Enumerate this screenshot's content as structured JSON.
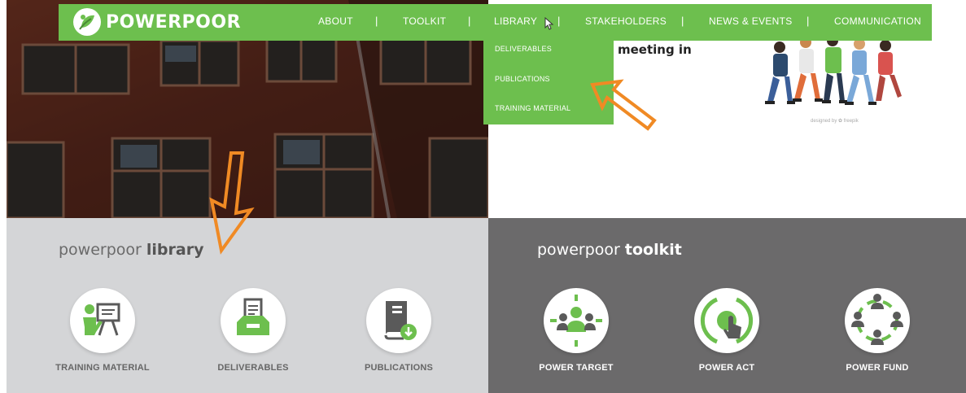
{
  "nav": {
    "logo_text": "POWERPOOR",
    "items": [
      {
        "label": "ABOUT"
      },
      {
        "label": "TOOLKIT"
      },
      {
        "label": "LIBRARY"
      },
      {
        "label": "STAKEHOLDERS"
      },
      {
        "label": "NEWS & EVENTS"
      },
      {
        "label": "COMMUNICATION"
      }
    ],
    "separator": "|"
  },
  "dropdown": {
    "items": [
      {
        "label": "DELIVERABLES"
      },
      {
        "label": "PUBLICATIONS"
      },
      {
        "label": "TRAINING MATERIAL"
      }
    ]
  },
  "hero": {
    "partial_text": "meeting in",
    "illustration_caption": "designed by ✿ freepik"
  },
  "library": {
    "title_prefix": "powerpoor ",
    "title_bold": "library",
    "items": [
      {
        "label": "TRAINING MATERIAL",
        "icon": "training-presentation-icon"
      },
      {
        "label": "DELIVERABLES",
        "icon": "document-tray-icon"
      },
      {
        "label": "PUBLICATIONS",
        "icon": "book-download-icon"
      }
    ]
  },
  "toolkit": {
    "title_prefix": "powerpoor ",
    "title_bold": "toolkit",
    "items": [
      {
        "label": "POWER TARGET",
        "icon": "target-group-icon"
      },
      {
        "label": "POWER ACT",
        "icon": "power-button-hand-icon"
      },
      {
        "label": "POWER FUND",
        "icon": "network-people-icon"
      }
    ]
  },
  "colors": {
    "brand_green": "#6dbf4e",
    "library_bg": "#d4d5d7",
    "toolkit_bg": "#6b6a6b",
    "annotation_orange": "#f08a24",
    "icon_dark": "#5a5a5a"
  }
}
